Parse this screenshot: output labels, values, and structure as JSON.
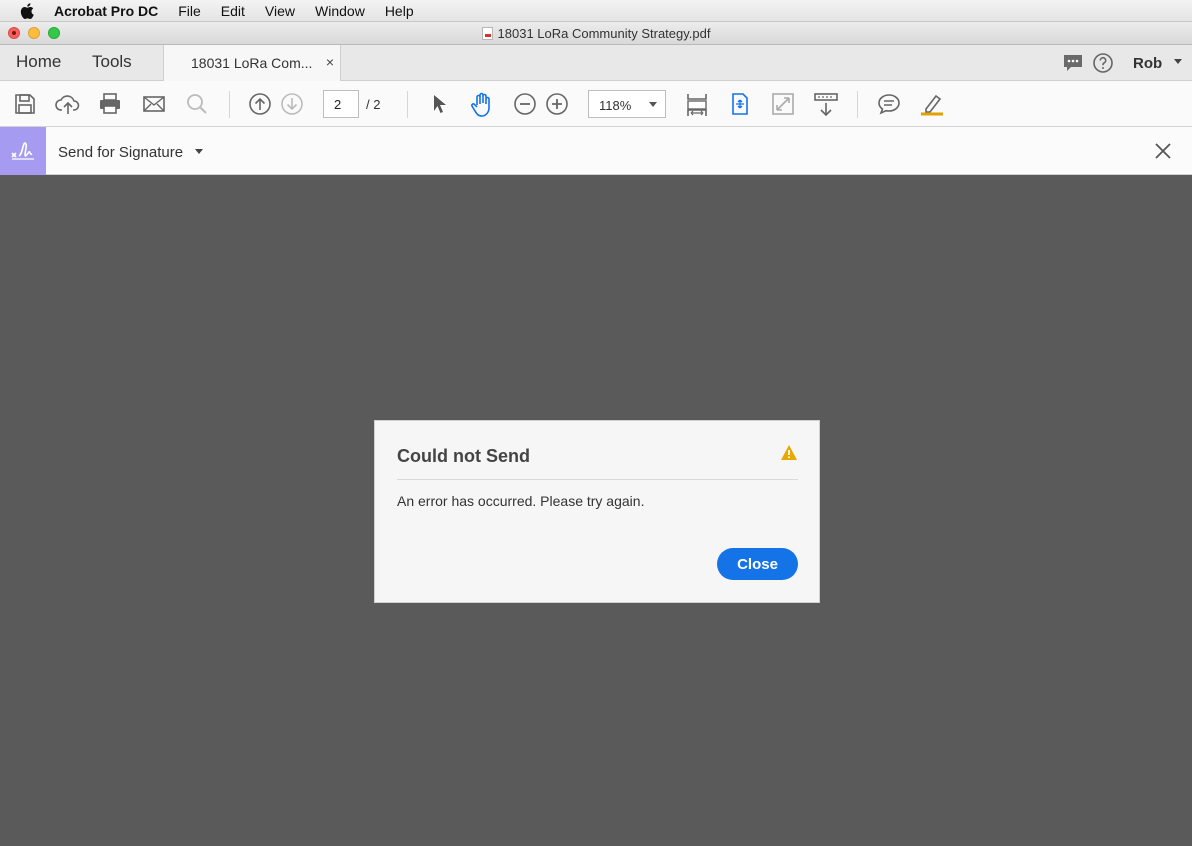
{
  "menubar": {
    "app_name": "Acrobat Pro DC",
    "items": [
      "File",
      "Edit",
      "View",
      "Window",
      "Help"
    ]
  },
  "window": {
    "title": "18031 LoRa Community Strategy.pdf"
  },
  "tabs": {
    "home": "Home",
    "tools": "Tools",
    "document_tab": "18031 LoRa Com...",
    "document_tab_close": "×",
    "user": "Rob"
  },
  "toolbar": {
    "current_page": "2",
    "total_pages": "/ 2",
    "zoom": "118%"
  },
  "signature_bar": {
    "label": "Send for Signature"
  },
  "dialog": {
    "title": "Could not Send",
    "message": "An error has occurred. Please try again.",
    "button": "Close"
  },
  "colors": {
    "accent": "#1473e6",
    "signature_tool": "#a59cf2",
    "warning": "#e8a800",
    "canvas": "#5a5a5a"
  },
  "icons": [
    "apple-icon",
    "save-icon",
    "cloud-upload-icon",
    "print-icon",
    "email-icon",
    "search-icon",
    "prev-page-icon",
    "next-page-icon",
    "select-arrow-icon",
    "hand-icon",
    "zoom-out-icon",
    "zoom-in-icon",
    "fit-page-icon",
    "rotate-icon",
    "fullscreen-icon",
    "scroll-mode-icon",
    "comment-icon",
    "highlight-icon",
    "chat-icon",
    "help-icon",
    "signature-icon",
    "close-icon",
    "warning-icon"
  ]
}
